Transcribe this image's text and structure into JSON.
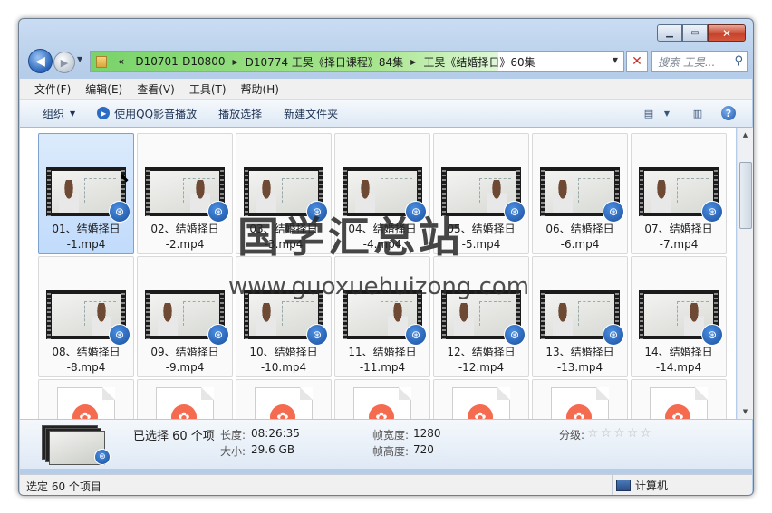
{
  "window": {
    "min_glyph": "▁",
    "max_glyph": "▭",
    "close_glyph": "✕"
  },
  "nav": {
    "back_glyph": "◀",
    "forward_glyph": "▶",
    "dropdown_glyph": "▼",
    "breadcrumb_prefix": "«",
    "breadcrumbs": [
      "D10701-D10800",
      "D10774 王昊《择日课程》84集",
      "王昊《结婚择日》60集"
    ],
    "separator": "▶",
    "address_dropdown_glyph": "▼",
    "refresh_glyph": "✕",
    "search_placeholder": "搜索 王昊...",
    "search_icon_glyph": "⚲"
  },
  "menu": [
    "文件(F)",
    "编辑(E)",
    "查看(V)",
    "工具(T)",
    "帮助(H)"
  ],
  "toolbar": {
    "organize": "组织",
    "dropdown_glyph": "▼",
    "play_qq": "使用QQ影音播放",
    "qq_icon_glyph": "▶",
    "play_selection": "播放选择",
    "new_folder": "新建文件夹",
    "views_glyph": "▤",
    "preview_glyph": "▥",
    "help_glyph": "?"
  },
  "files": [
    {
      "name": "01、结婚择日\n-1.mp4",
      "selected": true
    },
    {
      "name": "02、结婚择日\n-2.mp4"
    },
    {
      "name": "03、结婚择日\n-3.mp4"
    },
    {
      "name": "04、结婚择日\n-4.mp4"
    },
    {
      "name": "05、结婚择日\n-5.mp4"
    },
    {
      "name": "06、结婚择日\n-6.mp4"
    },
    {
      "name": "07、结婚择日\n-7.mp4"
    },
    {
      "name": "08、结婚择日\n-8.mp4"
    },
    {
      "name": "09、结婚择日\n-9.mp4"
    },
    {
      "name": "10、结婚择日\n-10.mp4"
    },
    {
      "name": "11、结婚择日\n-11.mp4"
    },
    {
      "name": "12、结婚择日\n-12.mp4"
    },
    {
      "name": "13、结婚择日\n-13.mp4"
    },
    {
      "name": "14、结婚择日\n-14.mp4"
    }
  ],
  "badge_glyph": "⊛",
  "doc_logo_glyph": "✿",
  "details": {
    "selected": "已选择 60 个项",
    "length_label": "长度:",
    "length_value": "08:26:35",
    "size_label": "大小:",
    "size_value": "29.6 GB",
    "frame_width_label": "帧宽度:",
    "frame_width_value": "1280",
    "frame_height_label": "帧高度:",
    "frame_height_value": "720",
    "rating_label": "分级:",
    "star_glyph": "☆",
    "rating": 0,
    "rating_max": 5
  },
  "status": {
    "left": "选定 60 个项目",
    "right": "计算机"
  },
  "scroll": {
    "up_glyph": "▲",
    "down_glyph": "▼"
  },
  "watermark": {
    "title": "国学汇总站",
    "url": "www.guoxuehuizong.com"
  }
}
